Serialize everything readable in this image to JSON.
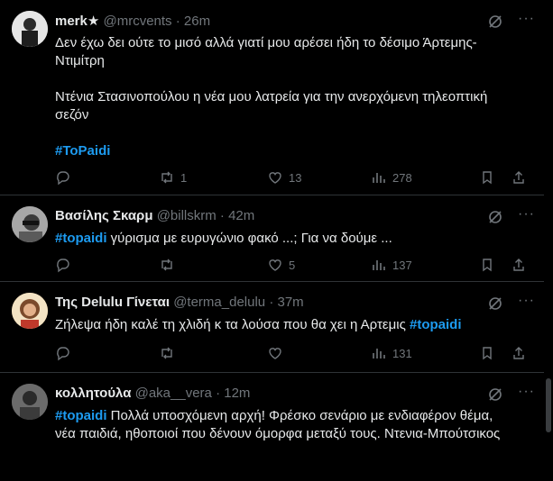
{
  "tweets": [
    {
      "name": "merk★",
      "handle": "@mrcvents",
      "sep": "·",
      "time": "26m",
      "line1": "Δεν έχω δει ούτε το μισό αλλά γιατί μου αρέσει ήδη το δέσιμο Άρτεμης-Ντιμίτρη",
      "line2": "Ντένια Στασινοπούλου η νέα μου λατρεία για την ανερχόμενη τηλεοπτική σεζόν",
      "hashtag": "#ToPaidi",
      "replies": "",
      "retweets": "1",
      "likes": "13",
      "views": "278"
    },
    {
      "name": "Βασίλης Σκαρμ",
      "handle": "@billskrm",
      "sep": "·",
      "time": "42m",
      "hashtag": "#topaidi",
      "text": " γύρισμα με ευρυγώνιο φακό ...; Για να δούμε ...",
      "replies": "",
      "retweets": "",
      "likes": "5",
      "views": "137"
    },
    {
      "name": "Της Delulu Γίνεται",
      "handle": "@terma_delulu",
      "sep": "·",
      "time": "37m",
      "text": "Ζήλεψα ήδη καλέ τη χλιδή κ τα λούσα που θα χει η Αρτεμις ",
      "hashtag": "#topaidi",
      "replies": "",
      "retweets": "",
      "likes": "",
      "views": "131"
    },
    {
      "name": "κολλητούλα",
      "handle": "@aka__vera",
      "sep": "·",
      "time": "12m",
      "hashtag": "#topaidi",
      "text": " Πολλά υποσχόμενη αρχή! Φρέσκο σενάριο με ενδιαφέρον θέμα,",
      "line2": "νέα παιδιά, ηθοποιοί που δένουν όμορφα μεταξύ τους. Ντενια-Μπούτσικος"
    }
  ],
  "icons": {
    "more": "more-icon",
    "grok": "grok-icon",
    "reply": "reply-icon",
    "retweet": "retweet-icon",
    "like": "like-icon",
    "views": "views-icon",
    "bookmark": "bookmark-icon",
    "share": "share-icon"
  },
  "colors": {
    "background": "#000000",
    "text": "#e7e9ea",
    "muted": "#71767b",
    "hashtag": "#1d9bf0",
    "divider": "#2f3336"
  }
}
